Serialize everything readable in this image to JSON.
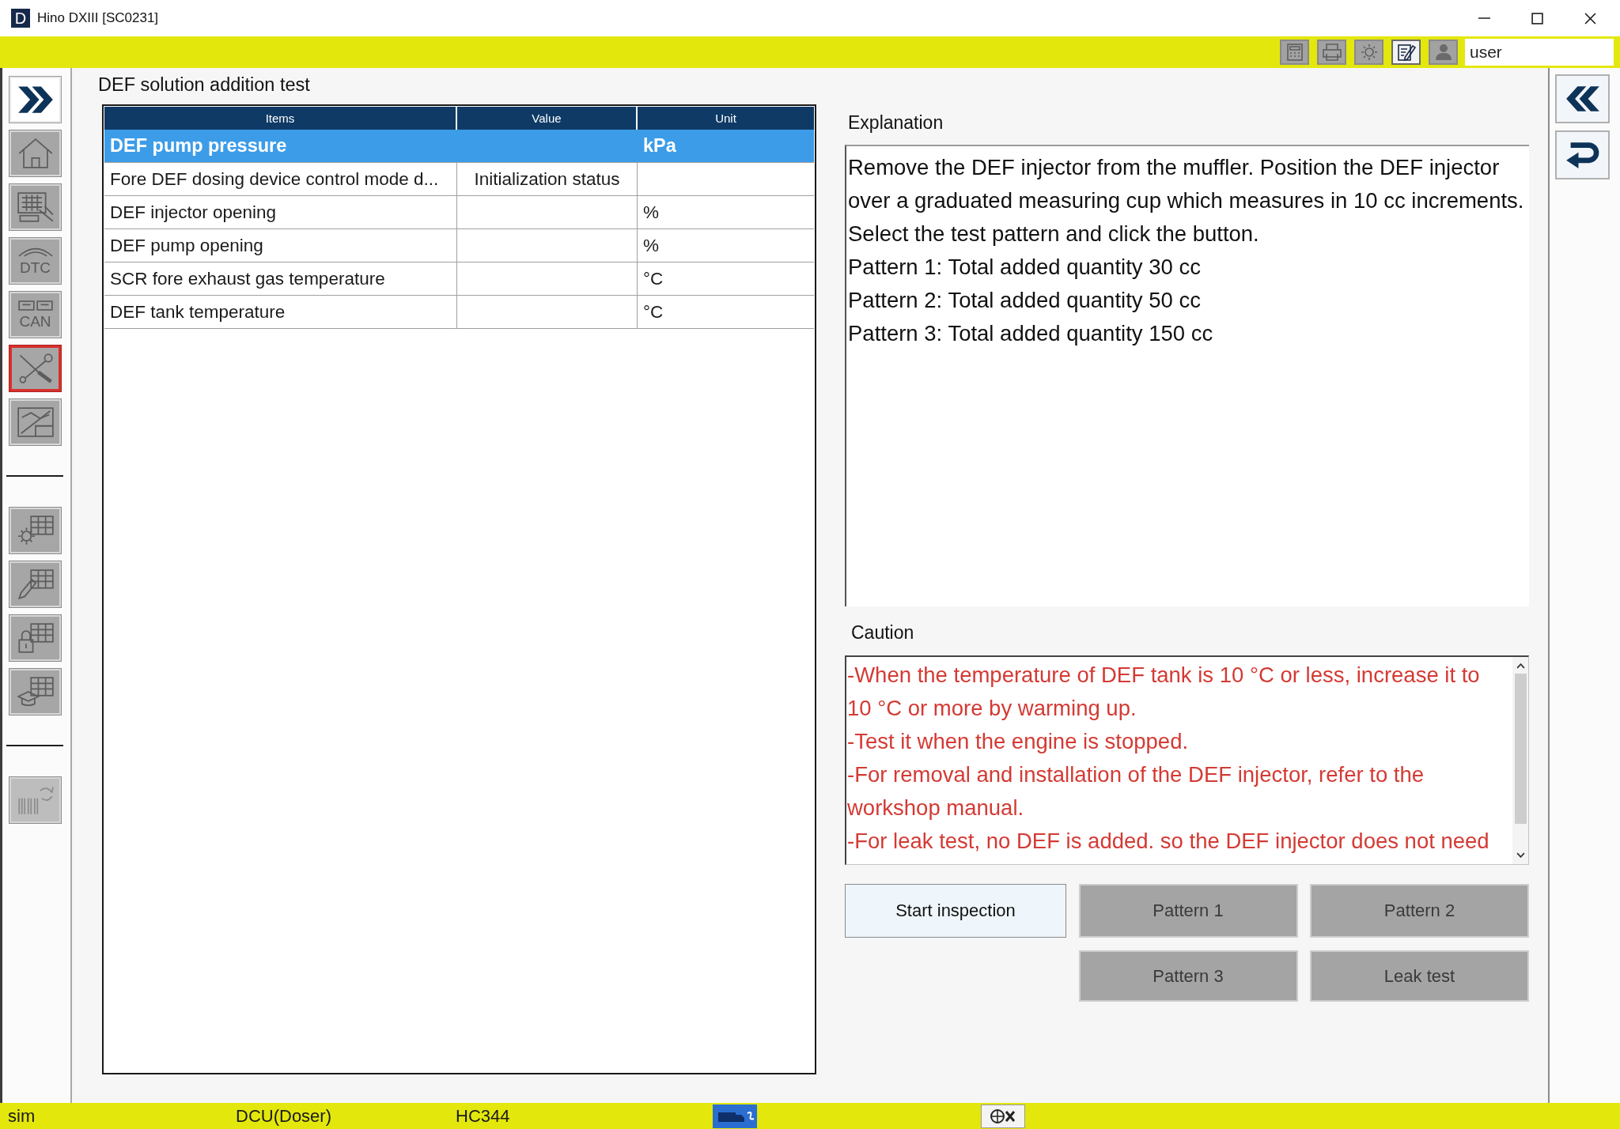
{
  "window": {
    "title": "Hino DXIII [SC0231]",
    "logo": "D"
  },
  "toolbar": {
    "buttons": [
      {
        "kind": "calculator",
        "selected": false
      },
      {
        "kind": "printer",
        "selected": false
      },
      {
        "kind": "gear",
        "selected": false
      },
      {
        "kind": "notepad",
        "selected": true
      },
      {
        "kind": "person",
        "selected": false
      }
    ],
    "user_field": {
      "value": "user"
    }
  },
  "left_sidebar": {
    "groups": [
      {
        "items": [
          {
            "kind": "forward",
            "selected": false,
            "disabled": false
          },
          {
            "kind": "home",
            "selected": false,
            "disabled": false
          },
          {
            "kind": "keyboard",
            "selected": false,
            "disabled": false
          },
          {
            "kind": "dtc",
            "caption": "DTC",
            "selected": false,
            "disabled": false
          },
          {
            "kind": "can",
            "caption": "CAN",
            "selected": false,
            "disabled": false
          },
          {
            "kind": "tools",
            "selected": true,
            "disabled": false
          },
          {
            "kind": "chart",
            "selected": false,
            "disabled": false
          }
        ]
      },
      {
        "items": [
          {
            "kind": "settings",
            "selected": false,
            "disabled": false
          },
          {
            "kind": "edit",
            "selected": false,
            "disabled": false
          },
          {
            "kind": "lock",
            "selected": false,
            "disabled": false
          },
          {
            "kind": "learn",
            "selected": false,
            "disabled": false
          }
        ]
      },
      {
        "items": [
          {
            "kind": "barcode",
            "selected": false,
            "disabled": true
          }
        ]
      }
    ]
  },
  "page_title": "DEF solution addition test",
  "table": {
    "columns": [
      "Items",
      "Value",
      "Unit"
    ],
    "rows": [
      {
        "item": "DEF pump pressure",
        "unit": "kPa",
        "selected": true
      },
      {
        "item": "Fore DEF dosing device control mode d...",
        "value": "Initialization status",
        "selected": false
      },
      {
        "item": "DEF injector opening",
        "unit": "%",
        "selected": false
      },
      {
        "item": "DEF pump opening",
        "unit": "%",
        "selected": false
      },
      {
        "item": "SCR fore exhaust gas temperature",
        "unit": "°C",
        "selected": false
      },
      {
        "item": "DEF tank temperature",
        "unit": "°C",
        "selected": false
      }
    ]
  },
  "explanation": {
    "label": "Explanation",
    "paragraphs": [
      "Remove the DEF injector from the muffler. Position the DEF injector over a graduated measuring cup which measures in 10 cc increments.",
      "Select the test pattern and click the button.",
      "Pattern 1: Total added quantity 30 cc",
      "Pattern 2: Total added quantity 50 cc",
      "Pattern 3: Total added quantity 150 cc"
    ]
  },
  "caution": {
    "label": "Caution",
    "lines": [
      "-When the temperature of DEF tank is 10 °C or less, increase it to 10 °C or more by warming up.",
      "-Test it when the engine is stopped.",
      "-For removal and installation of the DEF injector, refer to the workshop manual.",
      "-For leak test, no DEF is added. so the DEF injector does not need"
    ]
  },
  "buttons": [
    {
      "label": "Start inspection",
      "disabled": false
    },
    {
      "label": "Pattern 1",
      "disabled": true
    },
    {
      "label": "Pattern 2",
      "disabled": true
    },
    {
      "label": "Pattern 3",
      "disabled": true
    },
    {
      "label": "Leak test",
      "disabled": true
    }
  ],
  "status_bar": {
    "texts": [
      "sim",
      "DCU(Doser)",
      "HC344"
    ]
  }
}
